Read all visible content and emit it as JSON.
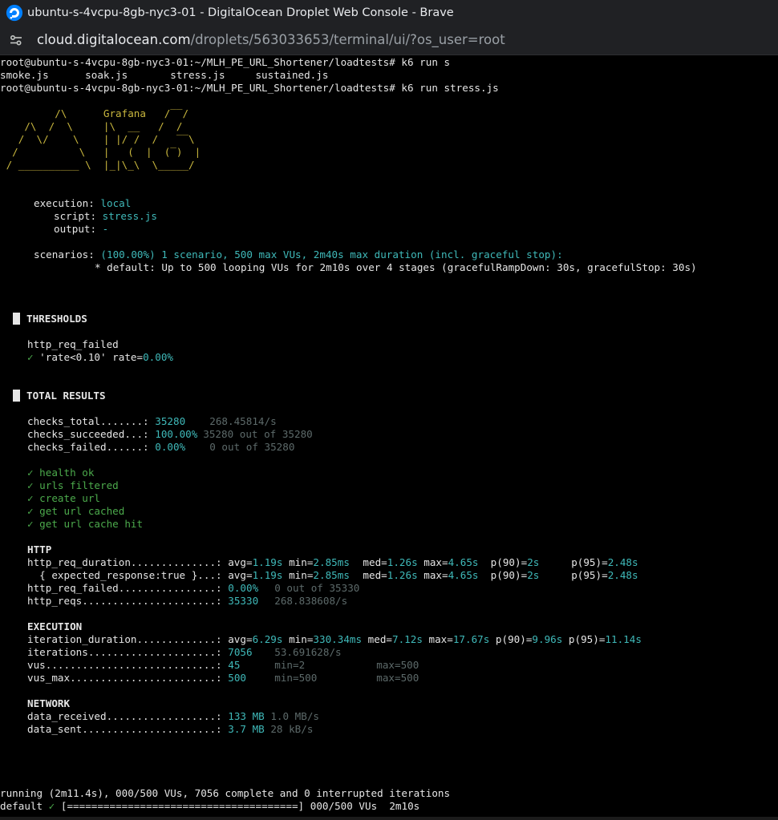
{
  "window": {
    "title": "ubuntu-s-4vcpu-8gb-nyc3-01 - DigitalOcean Droplet Web Console - Brave",
    "icon": "digitalocean-logo-icon"
  },
  "address_bar": {
    "host": "cloud.digitalocean.com",
    "path": "/droplets/563033653/terminal/ui/?os_user=root",
    "icon": "site-settings-icon"
  },
  "terminal": {
    "cmd1_prompt": "root@ubuntu-s-4vcpu-8gb-nyc3-01:~/MLH_PE_URL_Shortener/loadtests#",
    "cmd1_text": " k6 run s",
    "completions": "smoke.js      soak.js       stress.js     sustained.js",
    "cmd2_prompt": "root@ubuntu-s-4vcpu-8gb-nyc3-01:~/MLH_PE_URL_Shortener/loadtests#",
    "cmd2_text": " k6 run stress.js",
    "logo_lines": [
      "         /\\      Grafana   /‾‾/  ",
      "    /\\  /  \\     |\\  __   /  /   ",
      "   /  \\/    \\    | |/ /  /   ‾‾\\ ",
      "  /          \\   |   (  |  (‾)  |",
      " / __________ \\  |_|\\_\\  \\_____/ "
    ],
    "execution": {
      "label": "execution:",
      "value": "local"
    },
    "script": {
      "label": "script:",
      "value": "stress.js"
    },
    "output": {
      "label": "output:",
      "value": "-"
    },
    "scenarios": {
      "label": "scenarios:",
      "value": "(100.00%) 1 scenario, 500 max VUs, 2m40s max duration (incl. graceful stop):",
      "detail": "* default: Up to 500 looping VUs for 2m10s over 4 stages (gracefulRampDown: 30s, gracefulStop: 30s)"
    },
    "thresholds": {
      "heading": "THRESHOLDS",
      "metric": "http_req_failed",
      "check_mark": "✓",
      "rule": " 'rate<0.10' rate=",
      "rate": "0.00%"
    },
    "total": {
      "heading": "TOTAL RESULTS",
      "checks_total": {
        "label": "checks_total.......:",
        "value": "35280",
        "extra": "268.45814/s"
      },
      "checks_succeeded": {
        "label": "checks_succeeded...:",
        "value": "100.00%",
        "extra": "35280 out of 35280"
      },
      "checks_failed": {
        "label": "checks_failed......:",
        "value": "0.00%",
        "extra": "0 out of 35280"
      },
      "checks": [
        "✓ health ok",
        "✓ urls filtered",
        "✓ create url",
        "✓ get url cached",
        "✓ get url cache hit"
      ]
    },
    "http": {
      "heading": "HTTP",
      "req_duration": {
        "label": "http_req_duration..............:",
        "avg": "1.19s",
        "min": "2.85ms",
        "med": "1.26s",
        "max": "4.65s",
        "p90": "2s",
        "p95": "2.48s"
      },
      "expected": {
        "label": "  { expected_response:true }...:",
        "avg": "1.19s",
        "min": "2.85ms",
        "med": "1.26s",
        "max": "4.65s",
        "p90": "2s",
        "p95": "2.48s"
      },
      "req_failed": {
        "label": "http_req_failed................:",
        "value": "0.00%",
        "extra": "0 out of 35330"
      },
      "reqs": {
        "label": "http_reqs......................:",
        "value": "35330",
        "extra": "268.838608/s"
      }
    },
    "exec": {
      "heading": "EXECUTION",
      "iteration_duration": {
        "label": "iteration_duration.............:",
        "avg": "6.29s",
        "min": "330.34ms",
        "med": "7.12s",
        "max": "17.67s",
        "p90": "9.96s",
        "p95": "11.14s"
      },
      "iterations": {
        "label": "iterations.....................:",
        "value": "7056",
        "extra": "53.691628/s"
      },
      "vus": {
        "label": "vus............................:",
        "value": "45",
        "min": "min=2",
        "max": "max=500"
      },
      "vus_max": {
        "label": "vus_max........................:",
        "value": "500",
        "min": "min=500",
        "max": "max=500"
      }
    },
    "network": {
      "heading": "NETWORK",
      "received": {
        "label": "data_received..................:",
        "value": "133 MB",
        "extra": "1.0 MB/s"
      },
      "sent": {
        "label": "data_sent......................:",
        "value": "3.7 MB",
        "extra": "28 kB/s"
      }
    },
    "status_line": "running (2m11.4s), 000/500 VUs, 7056 complete and 0 interrupted iterations",
    "progress": {
      "name": "default",
      "check": "✓",
      "bar": "[======================================]",
      "vus": "000/500 VUs",
      "elapsed": "2m10s",
      "fraction": 1.0
    }
  }
}
